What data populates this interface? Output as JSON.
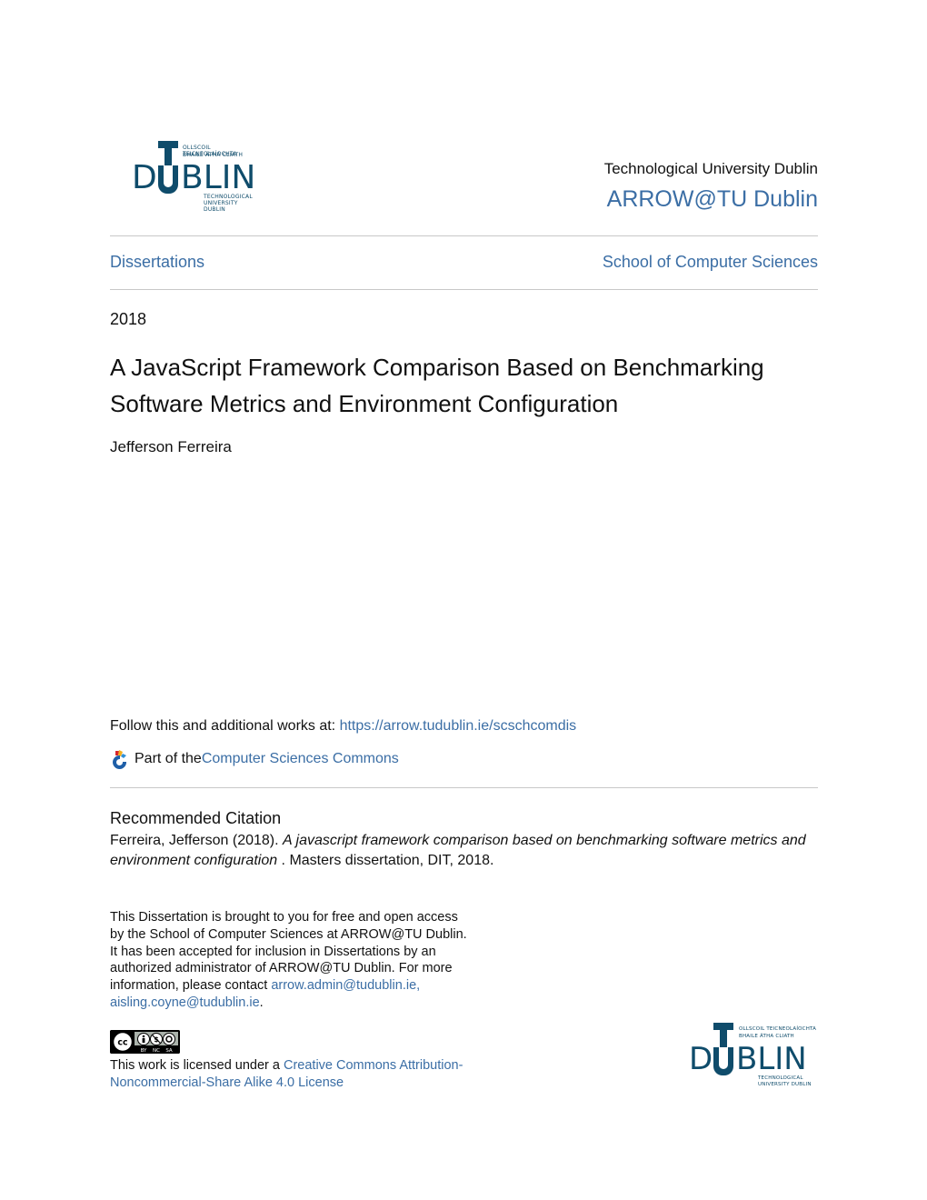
{
  "logo": {
    "letters_left": "D",
    "letters_right": "BLIN",
    "t_letter": "T",
    "u_letter": "U",
    "irish_line1": "OLLSCOIL TEICNEOLAÍOCHTA",
    "irish_line2": "BHAILE ÁTHA CLIATH",
    "english_line1": "TECHNOLOGICAL",
    "english_line2": "UNIVERSITY DUBLIN",
    "color": "#0f4c6b"
  },
  "header": {
    "institution": "Technological University Dublin",
    "repository": "ARROW@TU Dublin"
  },
  "nav": {
    "collection": "Dissertations",
    "school": "School of Computer Sciences"
  },
  "paper": {
    "year": "2018",
    "title": "A JavaScript Framework Comparison Based on Benchmarking Software Metrics and Environment Configuration",
    "author": "Jefferson Ferreira"
  },
  "links": {
    "follow_prefix": "Follow this and additional works at: ",
    "follow_url": "https://arrow.tudublin.ie/scschcomdis",
    "partof_prefix": "Part of the ",
    "partof_link": "Computer Sciences Commons"
  },
  "citation": {
    "heading": "Recommended Citation",
    "authors_year": "Ferreira, Jefferson (2018). ",
    "title_italic": "A javascript framework comparison based on benchmarking software metrics and environment configuration",
    "suffix": " . Masters dissertation, DIT, 2018."
  },
  "notice": {
    "text": "This Dissertation is brought to you for free and open access by the School of Computer Sciences at ARROW@TU Dublin. It has been accepted for inclusion in Dissertations by an authorized administrator of ARROW@TU Dublin. For more information, please contact ",
    "email1": "arrow.admin@tudublin.ie,",
    "email2": "aisling.coyne@tudublin.ie",
    "end": "."
  },
  "license": {
    "badge_labels": [
      "BY",
      "NC",
      "SA"
    ],
    "badge_cc": "cc",
    "prefix": "This work is licensed under a ",
    "link": "Creative Commons Attribution-Noncommercial-Share Alike 4.0 License"
  },
  "colors": {
    "link": "#3b6ea5",
    "rule": "#c8c8c8",
    "text": "#111111"
  }
}
